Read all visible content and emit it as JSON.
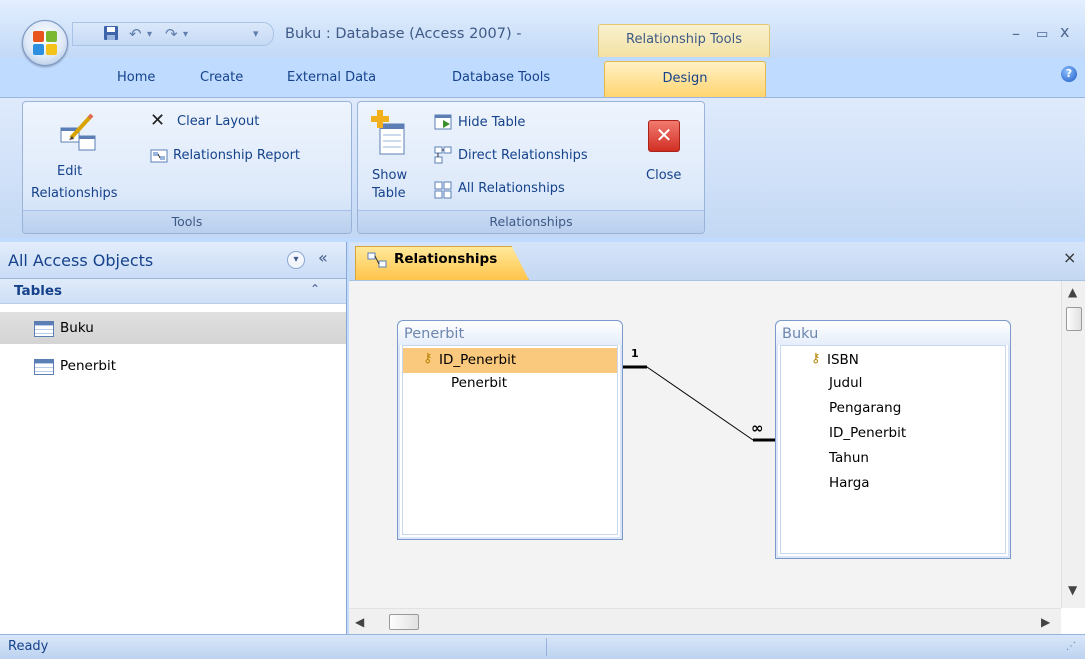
{
  "titlebar": {
    "title": "Buku : Database (Access 2007) -",
    "context_tab": "Relationship Tools",
    "minimize": "–",
    "maximize": "▭",
    "close": "x"
  },
  "ribbon": {
    "tabs": [
      "Home",
      "Create",
      "External Data",
      "Database Tools",
      "Design"
    ],
    "active_tab": "Design",
    "help": "?",
    "groups": {
      "tools": {
        "label": "Tools",
        "edit_relationships_line1": "Edit",
        "edit_relationships_line2": "Relationships",
        "clear_layout": "Clear Layout",
        "relationship_report": "Relationship Report"
      },
      "relationships": {
        "label": "Relationships",
        "show_table_line1": "Show",
        "show_table_line2": "Table",
        "hide_table": "Hide Table",
        "direct_relationships": "Direct Relationships",
        "all_relationships": "All Relationships",
        "close": "Close"
      }
    }
  },
  "nav_pane": {
    "title": "All Access Objects",
    "group": "Tables",
    "items": [
      {
        "label": "Buku",
        "selected": true
      },
      {
        "label": "Penerbit",
        "selected": false
      }
    ]
  },
  "document": {
    "tab_label": "Relationships",
    "close": "×",
    "tables": [
      {
        "name": "Penerbit",
        "fields": [
          "ID_Penerbit",
          "Penerbit"
        ],
        "primary_key": "ID_Penerbit"
      },
      {
        "name": "Buku",
        "fields": [
          "ISBN",
          "Judul",
          "Pengarang",
          "ID_Penerbit",
          "Tahun",
          "Harga"
        ],
        "primary_key": "ISBN"
      }
    ],
    "relationship": {
      "one_label": "1",
      "many_label": "∞"
    }
  },
  "status_bar": {
    "text": "Ready"
  },
  "colors": {
    "accent_tab": "#ffd46e",
    "selected_field": "#fbc97d",
    "close_button": "#e0443a"
  }
}
